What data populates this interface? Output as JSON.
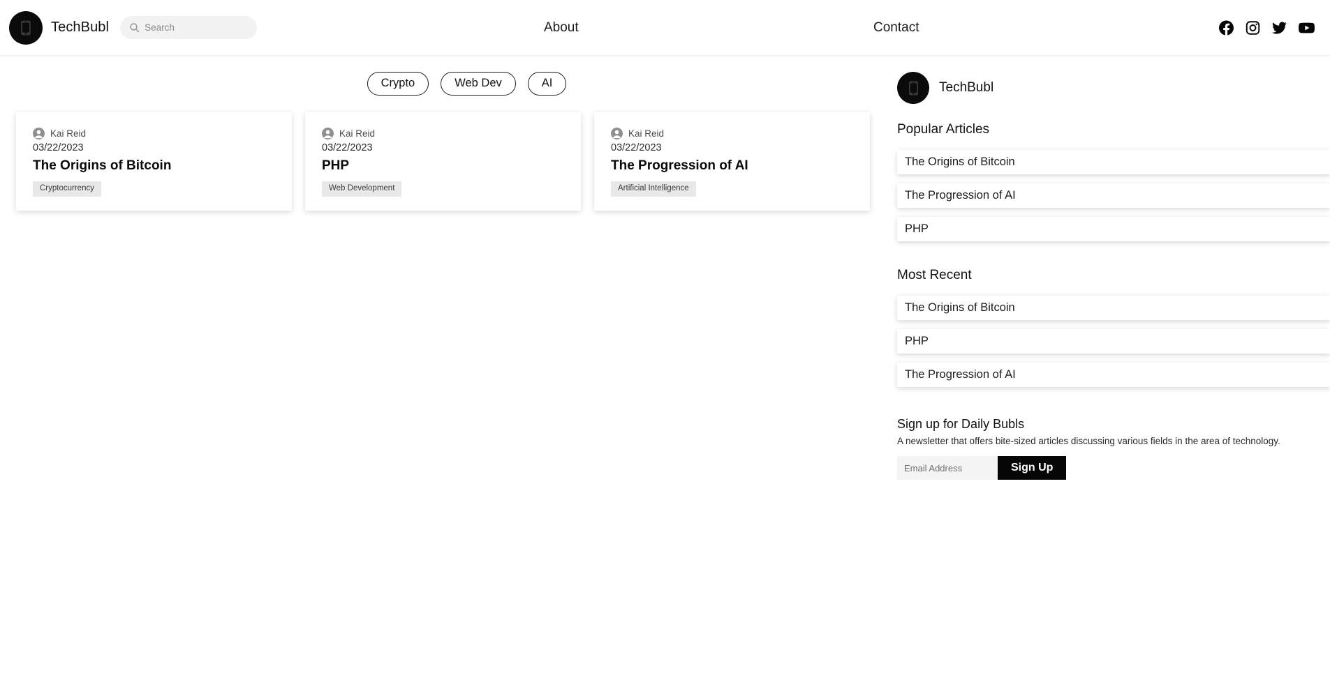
{
  "header": {
    "logo_icon": "phone-logo-icon",
    "brand_name": "TechBubl",
    "search": {
      "icon": "search-icon",
      "placeholder": "Search",
      "value": ""
    },
    "nav": [
      {
        "label": "About",
        "name": "nav-about"
      },
      {
        "label": "Contact",
        "name": "nav-contact"
      }
    ],
    "socials": [
      {
        "name": "facebook-icon",
        "label": "Facebook"
      },
      {
        "name": "instagram-icon",
        "label": "Instagram"
      },
      {
        "name": "twitter-icon",
        "label": "Twitter"
      },
      {
        "name": "youtube-icon",
        "label": "YouTube"
      }
    ]
  },
  "filters": [
    {
      "label": "Crypto"
    },
    {
      "label": "Web Dev"
    },
    {
      "label": "AI"
    }
  ],
  "articles": [
    {
      "author": "Kai Reid",
      "date": "03/22/2023",
      "title": "The Origins of Bitcoin",
      "tag": "Cryptocurrency"
    },
    {
      "author": "Kai Reid",
      "date": "03/22/2023",
      "title": "PHP",
      "tag": "Web Development"
    },
    {
      "author": "Kai Reid",
      "date": "03/22/2023",
      "title": "The Progression of AI",
      "tag": "Artificial Intelligence"
    }
  ],
  "sidebar": {
    "logo_icon": "phone-logo-icon",
    "brand_name": "TechBubl",
    "popular": {
      "heading": "Popular Articles",
      "items": [
        {
          "title": "The Origins of Bitcoin"
        },
        {
          "title": "The Progression of AI"
        },
        {
          "title": "PHP"
        }
      ]
    },
    "recent": {
      "heading": "Most Recent",
      "items": [
        {
          "title": "The Origins of Bitcoin"
        },
        {
          "title": "PHP"
        },
        {
          "title": "The Progression of AI"
        }
      ]
    },
    "newsletter": {
      "title": "Sign up for Daily Bubls",
      "description": "A newsletter that offers bite-sized articles discussing various fields in the area of technology.",
      "email_placeholder": "Email Address",
      "email_value": "",
      "button_label": "Sign Up"
    }
  },
  "colors": {
    "background": "#ffffff",
    "logo_black": "#0b0b0b",
    "tag_bg": "#e8e8e8",
    "search_bg": "#f2f2f3",
    "button_black": "#060606"
  }
}
